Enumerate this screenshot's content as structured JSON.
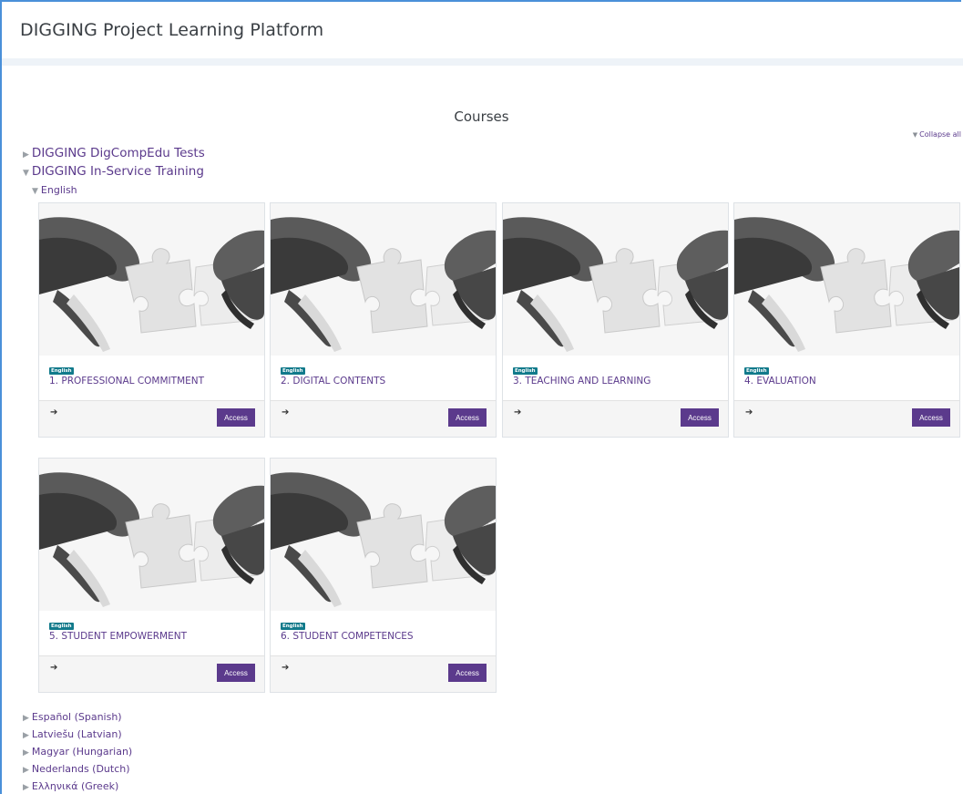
{
  "site": {
    "title": "DIGGING Project Learning Platform"
  },
  "courses_heading": "Courses",
  "collapse_all": "Collapse all",
  "categories": [
    {
      "label": "DIGGING DigCompEdu Tests",
      "expanded": false
    },
    {
      "label": "DIGGING In-Service Training",
      "expanded": true
    }
  ],
  "subcategory": {
    "label": "English",
    "expanded": true
  },
  "courses": [
    {
      "badge": "English",
      "title": "1. PROFESSIONAL COMMITMENT",
      "button": "Access",
      "icon": "sign-in-icon"
    },
    {
      "badge": "English",
      "title": "2. DIGITAL CONTENTS",
      "button": "Access",
      "icon": "sign-in-icon"
    },
    {
      "badge": "English",
      "title": "3. TEACHING AND LEARNING",
      "button": "Access",
      "icon": "sign-in-icon"
    },
    {
      "badge": "English",
      "title": "4. EVALUATION",
      "button": "Access",
      "icon": "sign-in-icon"
    },
    {
      "badge": "English",
      "title": "5. STUDENT EMPOWERMENT",
      "button": "Access",
      "icon": "sign-in-icon"
    },
    {
      "badge": "English",
      "title": "6. STUDENT COMPETENCES",
      "button": "Access",
      "icon": "sign-in-icon"
    }
  ],
  "languages": [
    {
      "label": "Español (Spanish)"
    },
    {
      "label": "Latviešu (Latvian)"
    },
    {
      "label": "Magyar (Hungarian)"
    },
    {
      "label": "Nederlands (Dutch)"
    },
    {
      "label": "Ελληνικά (Greek)"
    }
  ],
  "colors": {
    "link": "#5b3a8c",
    "button": "#5b3a8c",
    "badge": "#117a8b",
    "frame": "#4a90d9"
  }
}
